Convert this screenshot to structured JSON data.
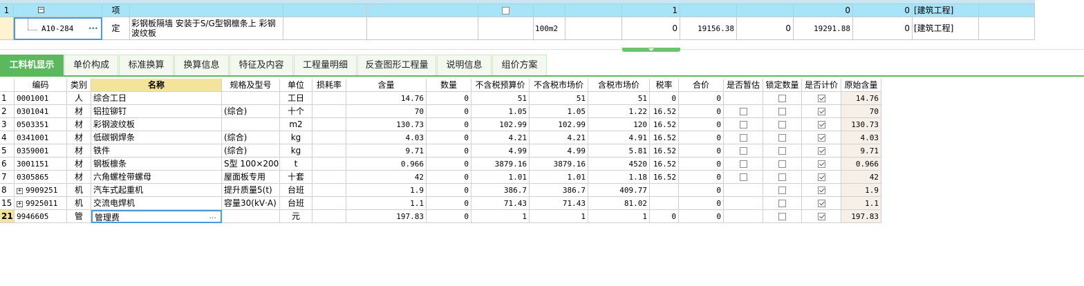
{
  "upper_grid": {
    "rows": [
      {
        "seq": "1",
        "code": "",
        "type": "项",
        "name": "",
        "col5": "",
        "col6": "",
        "col7": "",
        "unit": "",
        "col9": "",
        "qty": "1",
        "col11": "",
        "col12": "",
        "col13": "0",
        "col14": "0",
        "category": "[建筑工程]",
        "expander": "−"
      },
      {
        "seq": "",
        "code": "A10-284",
        "code_more": "···",
        "type": "定",
        "name": "彩钢板隔墙 安装于S/G型钢檩条上 彩钢波纹板",
        "col5": "",
        "col6": "",
        "col7": "",
        "unit": "100m2",
        "col9": "",
        "qty": "0",
        "col11": "19156.38",
        "col12": "0",
        "col13": "19291.88",
        "col14": "0",
        "category": "[建筑工程]"
      }
    ]
  },
  "tabs": [
    {
      "label": "工料机显示",
      "active": true
    },
    {
      "label": "单价构成"
    },
    {
      "label": "标准换算"
    },
    {
      "label": "换算信息"
    },
    {
      "label": "特征及内容"
    },
    {
      "label": "工程量明细"
    },
    {
      "label": "反查图形工程量"
    },
    {
      "label": "说明信息"
    },
    {
      "label": "组价方案"
    }
  ],
  "resource_grid": {
    "headers": [
      "编码",
      "类别",
      "名称",
      "规格及型号",
      "单位",
      "损耗率",
      "含量",
      "数量",
      "不含税预算价",
      "不含税市场价",
      "含税市场价",
      "税率",
      "合价",
      "是否暂估",
      "锁定数量",
      "是否计价",
      "原始含量"
    ],
    "rows": [
      {
        "seq": "1",
        "code": "0001001",
        "type": "人",
        "name": "综合工日",
        "spec": "",
        "unit": "工日",
        "loss": "",
        "content": "14.76",
        "qty": "0",
        "pre_price": "51",
        "market_price": "51",
        "tax_price": "51",
        "tax_rate": "0",
        "total": "0",
        "is_est": null,
        "locked": false,
        "is_priced": true,
        "orig": "14.76"
      },
      {
        "seq": "2",
        "code": "0301041",
        "type": "材",
        "name": "铝拉铆钉",
        "spec": "(综合)",
        "unit": "十个",
        "loss": "",
        "content": "70",
        "qty": "0",
        "pre_price": "1.05",
        "market_price": "1.05",
        "tax_price": "1.22",
        "tax_rate": "16.52",
        "total": "0",
        "is_est": false,
        "locked": false,
        "is_priced": true,
        "orig": "70"
      },
      {
        "seq": "3",
        "code": "0503351",
        "type": "材",
        "name": "彩钢波纹板",
        "spec": "",
        "unit": "m2",
        "loss": "",
        "content": "130.73",
        "qty": "0",
        "pre_price": "102.99",
        "market_price": "102.99",
        "tax_price": "120",
        "tax_rate": "16.52",
        "total": "0",
        "is_est": false,
        "locked": false,
        "is_priced": true,
        "orig": "130.73"
      },
      {
        "seq": "4",
        "code": "0341001",
        "type": "材",
        "name": "低碳钢焊条",
        "spec": "(综合)",
        "unit": "kg",
        "loss": "",
        "content": "4.03",
        "qty": "0",
        "pre_price": "4.21",
        "market_price": "4.21",
        "tax_price": "4.91",
        "tax_rate": "16.52",
        "total": "0",
        "is_est": false,
        "locked": false,
        "is_priced": true,
        "orig": "4.03"
      },
      {
        "seq": "5",
        "code": "0359001",
        "type": "材",
        "name": "铁件",
        "spec": "(综合)",
        "unit": "kg",
        "loss": "",
        "content": "9.71",
        "qty": "0",
        "pre_price": "4.99",
        "market_price": "4.99",
        "tax_price": "5.81",
        "tax_rate": "16.52",
        "total": "0",
        "is_est": false,
        "locked": false,
        "is_priced": true,
        "orig": "9.71"
      },
      {
        "seq": "6",
        "code": "3001151",
        "type": "材",
        "name": "钢板檩条",
        "spec": "S型 100×200",
        "unit": "t",
        "loss": "",
        "content": "0.966",
        "qty": "0",
        "pre_price": "3879.16",
        "market_price": "3879.16",
        "tax_price": "4520",
        "tax_rate": "16.52",
        "total": "0",
        "is_est": false,
        "locked": false,
        "is_priced": true,
        "orig": "0.966"
      },
      {
        "seq": "7",
        "code": "0305865",
        "type": "材",
        "name": "六角螺栓带螺母",
        "spec": "屋面板专用",
        "unit": "十套",
        "loss": "",
        "content": "42",
        "qty": "0",
        "pre_price": "1.01",
        "market_price": "1.01",
        "tax_price": "1.18",
        "tax_rate": "16.52",
        "total": "0",
        "is_est": false,
        "locked": false,
        "is_priced": true,
        "orig": "42"
      },
      {
        "seq": "8",
        "code": "9909251",
        "type": "机",
        "name": "汽车式起重机",
        "spec": "提升质量5(t)",
        "unit": "台班",
        "loss": "",
        "content": "1.9",
        "qty": "0",
        "pre_price": "386.7",
        "market_price": "386.7",
        "tax_price": "409.77",
        "tax_rate": "",
        "total": "0",
        "is_est": null,
        "locked": false,
        "is_priced": true,
        "orig": "1.9",
        "expander": "+"
      },
      {
        "seq": "15",
        "code": "9925011",
        "type": "机",
        "name": "交流电焊机",
        "spec": "容量30(kV·A)",
        "unit": "台班",
        "loss": "",
        "content": "1.1",
        "qty": "0",
        "pre_price": "71.43",
        "market_price": "71.43",
        "tax_price": "81.02",
        "tax_rate": "",
        "total": "0",
        "is_est": null,
        "locked": false,
        "is_priced": true,
        "orig": "1.1",
        "expander": "+"
      },
      {
        "seq": "21",
        "code": "9946605",
        "type": "管",
        "name": "管理费",
        "spec": "",
        "unit": "元",
        "loss": "",
        "content": "197.83",
        "qty": "0",
        "pre_price": "1",
        "market_price": "1",
        "tax_price": "1",
        "tax_rate": "0",
        "total": "0",
        "is_est": null,
        "locked": false,
        "is_priced": true,
        "orig": "197.83",
        "current": true,
        "name_more": "···"
      }
    ]
  },
  "colors": {
    "accent_green": "#5cb85c",
    "selected_row": "#a8e4f8",
    "header_highlight": "#f4e39a"
  }
}
